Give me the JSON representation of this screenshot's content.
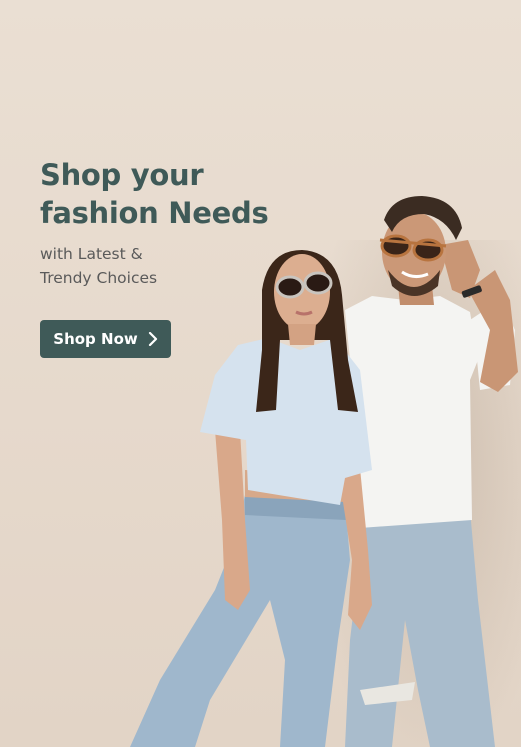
{
  "hero": {
    "title_line1": "Shop your",
    "title_line2": "fashion Needs",
    "subtitle_line1": "with Latest &",
    "subtitle_line2": "Trendy Choices",
    "cta_label": "Shop Now",
    "cta_icon": "chevron-right-icon"
  },
  "colors": {
    "background": "#e8ddd0",
    "accent": "#3f5a58",
    "button_text": "#ffffff",
    "subtitle": "#5a5a5a"
  }
}
